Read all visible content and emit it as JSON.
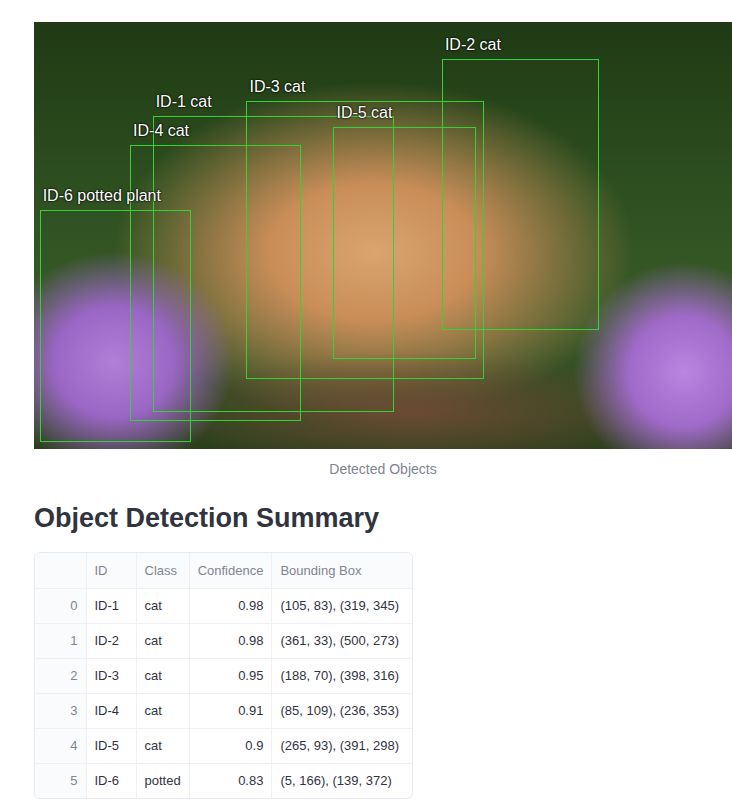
{
  "image": {
    "caption": "Detected Objects",
    "overlays": [
      {
        "label": "ID-1 cat"
      },
      {
        "label": "ID-2 cat"
      },
      {
        "label": "ID-3 cat"
      },
      {
        "label": "ID-4 cat"
      },
      {
        "label": "ID-5 cat"
      },
      {
        "label": "ID-6 potted plant"
      }
    ]
  },
  "heading": "Object Detection Summary",
  "table": {
    "columns": [
      "",
      "ID",
      "Class",
      "Confidence",
      "Bounding Box"
    ],
    "rows": [
      {
        "index": "0",
        "id": "ID-1",
        "class": "cat",
        "confidence": "0.98",
        "bbox": "(105, 83), (319, 345)"
      },
      {
        "index": "1",
        "id": "ID-2",
        "class": "cat",
        "confidence": "0.98",
        "bbox": "(361, 33), (500, 273)"
      },
      {
        "index": "2",
        "id": "ID-3",
        "class": "cat",
        "confidence": "0.95",
        "bbox": "(188, 70), (398, 316)"
      },
      {
        "index": "3",
        "id": "ID-4",
        "class": "cat",
        "confidence": "0.91",
        "bbox": "(85, 109), (236, 353)"
      },
      {
        "index": "4",
        "id": "ID-5",
        "class": "cat",
        "confidence": "0.9",
        "bbox": "(265, 93), (391, 298)"
      },
      {
        "index": "5",
        "id": "ID-6",
        "class": "potted",
        "confidence": "0.83",
        "bbox": "(5, 166), (139, 372)"
      }
    ]
  }
}
